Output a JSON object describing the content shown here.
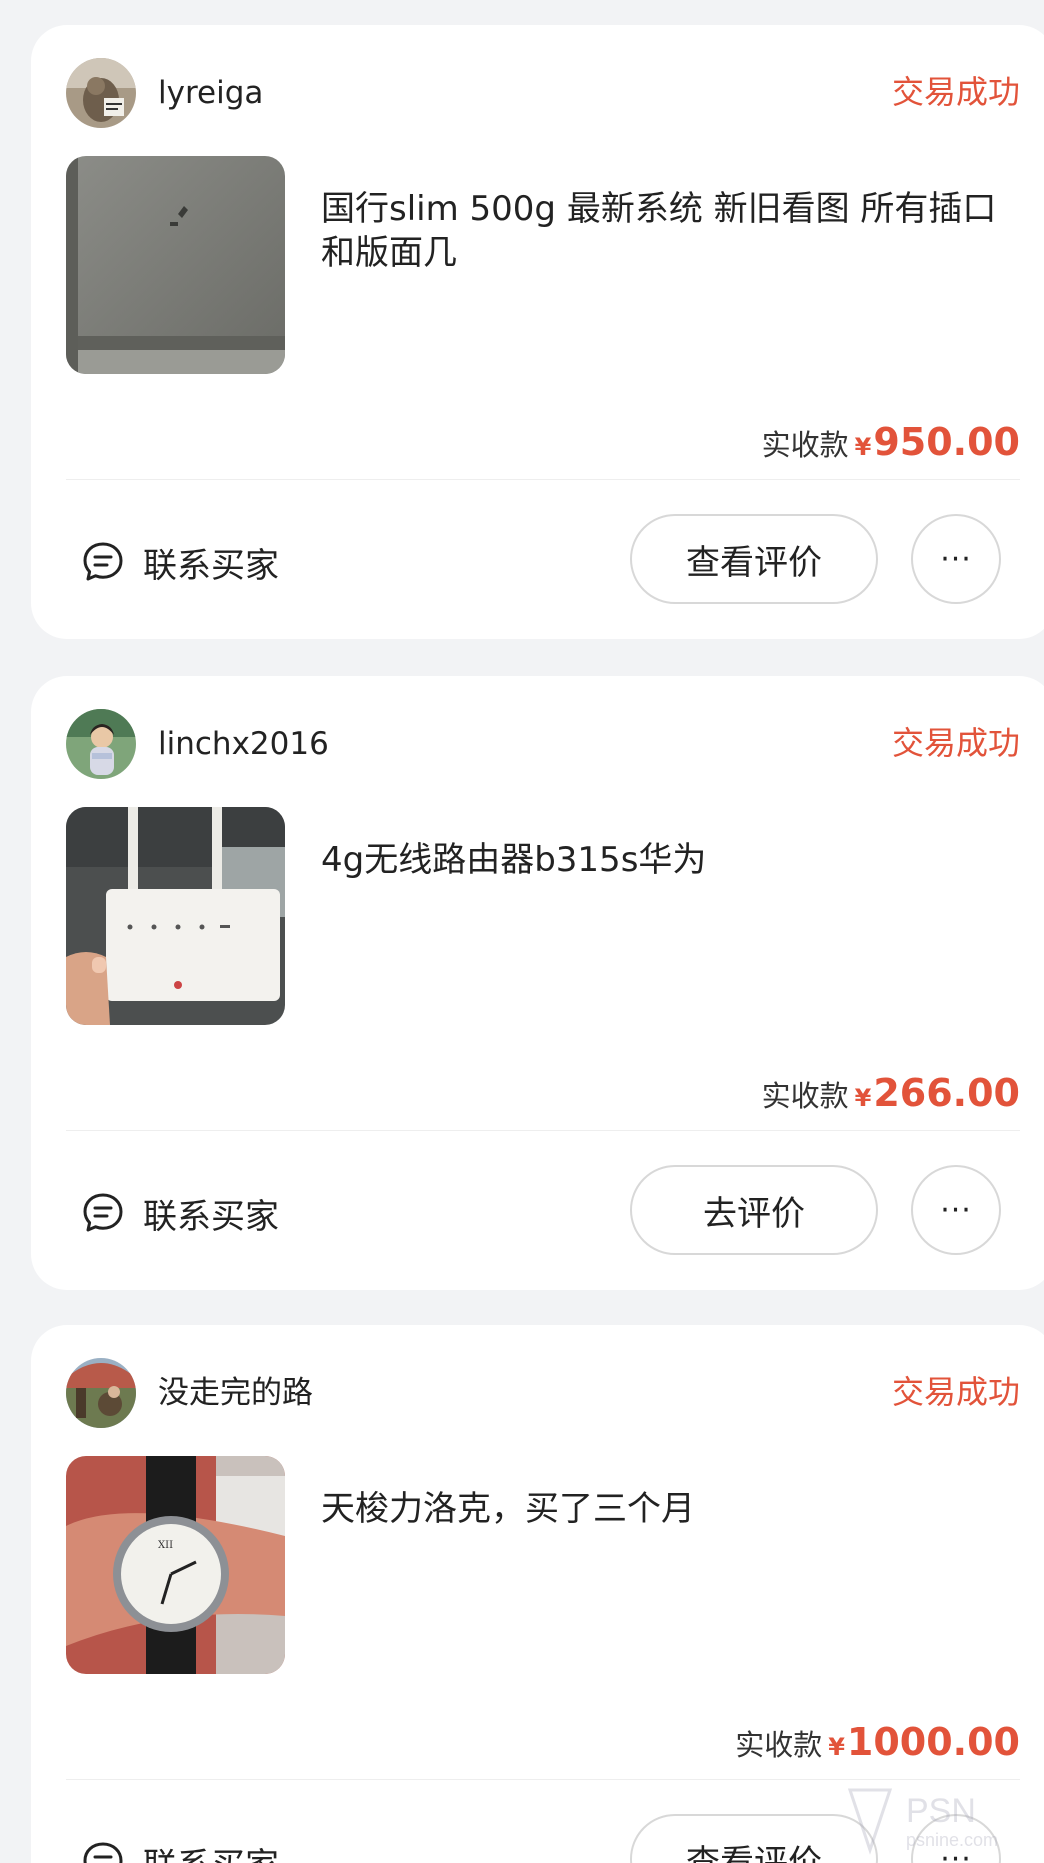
{
  "orders": [
    {
      "username": "lyreiga",
      "status": "交易成功",
      "title": "国行slim 500g 最新系统 新旧看图 所有插口和版面几",
      "price_label": "实收款",
      "price_symbol": "¥",
      "price": "950.00",
      "contact_label": "联系买家",
      "action_label": "查看评价",
      "more_label": "···"
    },
    {
      "username": "linchx2016",
      "status": "交易成功",
      "title": "4g无线路由器b315s华为",
      "price_label": "实收款",
      "price_symbol": "¥",
      "price": "266.00",
      "contact_label": "联系买家",
      "action_label": "去评价",
      "more_label": "···"
    },
    {
      "username": "没走完的路",
      "status": "交易成功",
      "title": "天梭力洛克，买了三个月",
      "price_label": "实收款",
      "price_symbol": "¥",
      "price": "1000.00",
      "contact_label": "联系买家",
      "action_label": "查看评价",
      "more_label": "···"
    }
  ],
  "watermark": {
    "text": "PSN",
    "subtext": "psnine.com"
  },
  "colors": {
    "status": "#e2533a",
    "price": "#e2533a",
    "background": "#f2f3f5",
    "card": "#ffffff"
  }
}
